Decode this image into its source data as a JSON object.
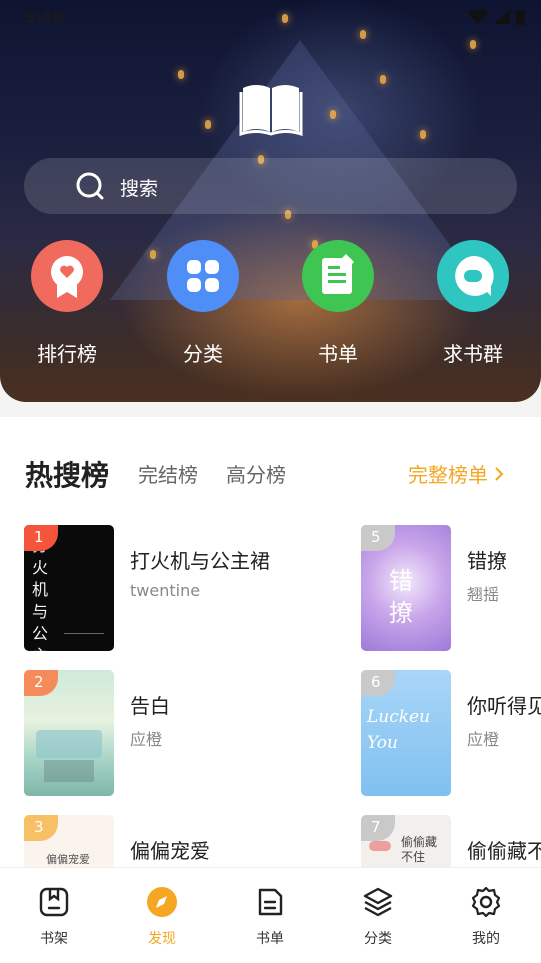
{
  "status_bar": {
    "time": "5:40"
  },
  "search": {
    "label": "搜索"
  },
  "quick_links": [
    {
      "label": "排行榜",
      "icon": "ranking-icon",
      "color": "#f06a5e"
    },
    {
      "label": "分类",
      "icon": "category-icon",
      "color": "#4f8ef7"
    },
    {
      "label": "书单",
      "icon": "booklist-icon",
      "color": "#3fc552"
    },
    {
      "label": "求书群",
      "icon": "chat-group-icon",
      "color": "#2fc5c0"
    }
  ],
  "ranking": {
    "tabs": [
      "热搜榜",
      "完结榜",
      "高分榜"
    ],
    "full_list_label": "完整榜单",
    "books": [
      {
        "rank": "1",
        "title": "打火机与公主裙",
        "author": "twentine"
      },
      {
        "rank": "2",
        "title": "告白",
        "author": "应橙"
      },
      {
        "rank": "3",
        "title": "偏偏宠爱",
        "author": ""
      },
      {
        "rank": "5",
        "title": "错撩",
        "author": "翘摇"
      },
      {
        "rank": "6",
        "title": "你听得见",
        "author": "应橙"
      },
      {
        "rank": "7",
        "title": "偷偷藏不住",
        "author": ""
      }
    ],
    "cover_texts": {
      "book1": "打火机与公主裙",
      "book3": "偏偏宠爱",
      "book5": "错撩",
      "book6": "Luckeu You",
      "book7": "偷偷藏不住"
    }
  },
  "bottom_nav": [
    {
      "label": "书架",
      "icon": "bookshelf-icon"
    },
    {
      "label": "发现",
      "icon": "discover-icon",
      "active": true
    },
    {
      "label": "书单",
      "icon": "booklist-icon"
    },
    {
      "label": "分类",
      "icon": "layers-icon"
    },
    {
      "label": "我的",
      "icon": "settings-icon"
    }
  ],
  "colors": {
    "accent": "#f5a623",
    "hot_rank": "#f5553a"
  }
}
